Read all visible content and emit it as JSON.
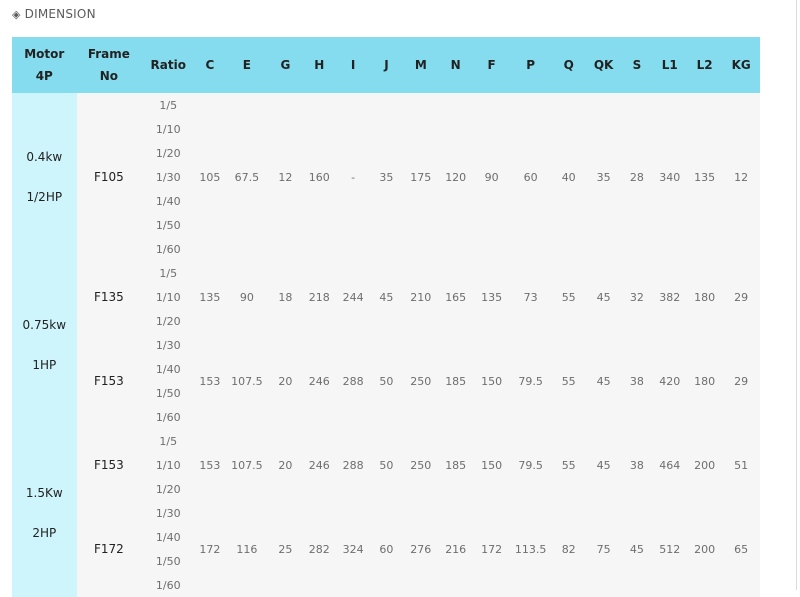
{
  "heading": {
    "icon": "diamond-icon",
    "text": "DIMENSION"
  },
  "columns": {
    "motor": [
      "Motor",
      "4P"
    ],
    "frame": [
      "Frame",
      "No"
    ],
    "ratio": "Ratio",
    "dims": [
      "C",
      "E",
      "G",
      "H",
      "I",
      "J",
      "M",
      "N",
      "F",
      "P",
      "Q",
      "QK",
      "S",
      "L1",
      "L2",
      "KG"
    ]
  },
  "ratios": [
    "1/5",
    "1/10",
    "1/20",
    "1/30",
    "1/40",
    "1/50",
    "1/60"
  ],
  "groups": [
    {
      "motor": [
        "0.4kw",
        "1/2HP"
      ],
      "frames": [
        {
          "frame": "F105",
          "rows": 7,
          "values": [
            "105",
            "67.5",
            "12",
            "160",
            "-",
            "35",
            "175",
            "120",
            "90",
            "60",
            "40",
            "35",
            "28",
            "340",
            "135",
            "12"
          ]
        }
      ]
    },
    {
      "motor": [
        "0.75kw",
        "1HP"
      ],
      "frames": [
        {
          "frame": "F135",
          "rows": 3,
          "values": [
            "135",
            "90",
            "18",
            "218",
            "244",
            "45",
            "210",
            "165",
            "135",
            "73",
            "55",
            "45",
            "32",
            "382",
            "180",
            "29"
          ]
        },
        {
          "frame": "F153",
          "rows": 4,
          "values": [
            "153",
            "107.5",
            "20",
            "246",
            "288",
            "50",
            "250",
            "185",
            "150",
            "79.5",
            "55",
            "45",
            "38",
            "420",
            "180",
            "29"
          ]
        }
      ]
    },
    {
      "motor": [
        "1.5Kw",
        "2HP"
      ],
      "frames": [
        {
          "frame": "F153",
          "rows": 3,
          "values": [
            "153",
            "107.5",
            "20",
            "246",
            "288",
            "50",
            "250",
            "185",
            "150",
            "79.5",
            "55",
            "45",
            "38",
            "464",
            "200",
            "51"
          ]
        },
        {
          "frame": "F172",
          "rows": 4,
          "values": [
            "172",
            "116",
            "25",
            "282",
            "324",
            "60",
            "276",
            "216",
            "172",
            "113.5",
            "82",
            "75",
            "45",
            "512",
            "200",
            "65"
          ]
        }
      ]
    }
  ]
}
